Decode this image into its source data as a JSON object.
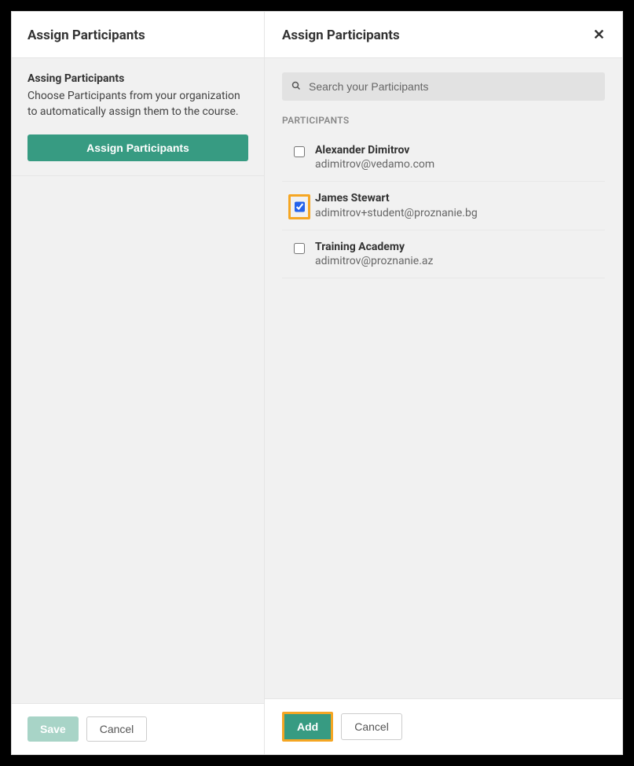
{
  "left": {
    "title": "Assign Participants",
    "subtitle": "Assing Participants",
    "description": "Choose Participants from your organization to automatically assign them to the course.",
    "assign_button": "Assign Participants",
    "save_label": "Save",
    "cancel_label": "Cancel"
  },
  "right": {
    "title": "Assign Participants",
    "search_placeholder": "Search your Participants",
    "section_label": "PARTICIPANTS",
    "add_label": "Add",
    "cancel_label": "Cancel"
  },
  "participants": [
    {
      "name": "Alexander Dimitrov",
      "email": "adimitrov@vedamo.com",
      "checked": false,
      "highlighted": false
    },
    {
      "name": "James Stewart",
      "email": "adimitrov+student@proznanie.bg",
      "checked": true,
      "highlighted": true
    },
    {
      "name": "Training Academy",
      "email": "adimitrov@proznanie.az",
      "checked": false,
      "highlighted": false
    }
  ],
  "colors": {
    "primary": "#379b82",
    "highlight": "#f5a623"
  }
}
